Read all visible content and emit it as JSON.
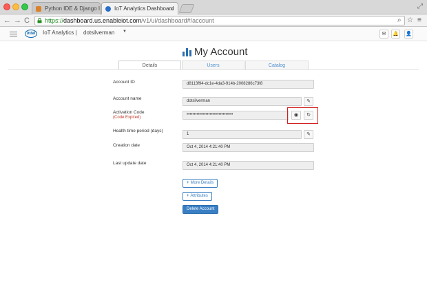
{
  "browser": {
    "tabs": [
      {
        "title": "Python IDE & Django IDE f",
        "close": "×"
      },
      {
        "title": "IoT Analytics Dashboard",
        "close": "×"
      }
    ],
    "url": {
      "scheme": "https://",
      "host": "dashboard.us.enableiot.com",
      "path": "/v1/ui/dashboard#/account"
    },
    "nav": {
      "back": "←",
      "forward": "→",
      "reload": "C"
    },
    "toolbar_icons": {
      "search": "⌕",
      "star": "☆",
      "menu": "≡"
    },
    "resize": "⤢"
  },
  "app": {
    "logo_text": "intel",
    "title": "IoT Analytics |",
    "username": "dotsilverman",
    "user_caret": "▼",
    "header_icons": {
      "mail": "✉",
      "bell": "🔔",
      "user": "👤"
    }
  },
  "page": {
    "title": "My Account",
    "tabs": [
      "Details",
      "Users",
      "Catalog"
    ],
    "active_tab": "Details"
  },
  "fields": {
    "account_id": {
      "label": "Account ID",
      "value": "d8113f94-dc1e-4da3-914b-2008286c73f8"
    },
    "account_name": {
      "label": "Account name",
      "value": "dotsilverman"
    },
    "activation_code": {
      "label": "Activation Code",
      "sublabel": "(Code Expired)",
      "value": "••••••••••••••••••••••••••••••••"
    },
    "health_time": {
      "label": "Health time period (days)",
      "value": "1"
    },
    "creation_date": {
      "label": "Creation date",
      "value": "Oct 4, 2014 4:21:40 PM"
    },
    "last_update": {
      "label": "Last update date",
      "value": "Oct 4, 2014 4:21:40 PM"
    }
  },
  "buttons": {
    "more_details": "More Details",
    "attributes": "Attributes",
    "delete_account": "Delete Account",
    "plus": "+",
    "edit_glyph": "✎",
    "show_glyph": "◉",
    "refresh_glyph": "↻"
  },
  "colors": {
    "accent": "#3a7fc4",
    "expired": "#c0392b",
    "highlight": "#d21f1f"
  }
}
